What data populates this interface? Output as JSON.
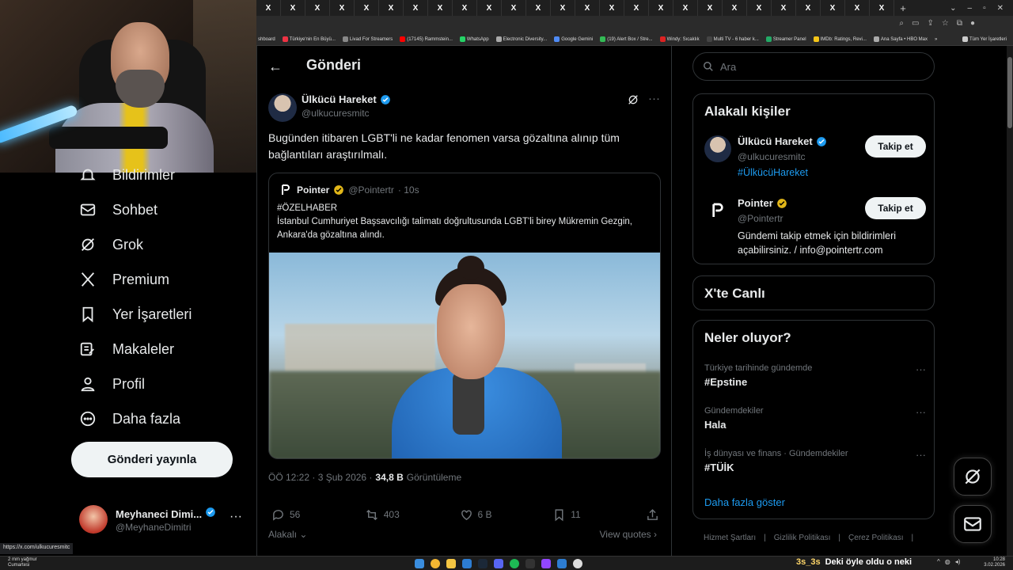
{
  "browser": {
    "tab_count_label": "X",
    "tabs": [
      "X",
      "X",
      "X",
      "X",
      "X",
      "X",
      "X",
      "X",
      "X",
      "X",
      "X",
      "X",
      "X",
      "X",
      "X",
      "X",
      "X",
      "X",
      "X",
      "X",
      "X",
      "X",
      "X",
      "X",
      "X",
      "X",
      "X",
      "X"
    ],
    "new_tab": "+",
    "bookmarks": [
      "shboard",
      "Türkiye'nin En Büyü...",
      "Livad For Streamers",
      "(17145) Rammstein...",
      "WhatsApp",
      "Electronic Diversity...",
      "Google Gemini",
      "(19) Alert Box / Stre...",
      "Windy: Sıcaklık",
      "Multi TV - 6 haber k...",
      "Streamer Panel",
      "IMDb: Ratings, Revi...",
      "Ana Sayfa • HBO Max"
    ],
    "bookmarks_overflow": "»",
    "all_bookmarks": "Tüm Yer İşaretleri",
    "status_url": "https://x.com/ulkucuresmitc"
  },
  "nav": {
    "items": [
      {
        "label": "Bildirimler"
      },
      {
        "label": "Sohbet"
      },
      {
        "label": "Grok"
      },
      {
        "label": "Premium"
      },
      {
        "label": "Yer İşaretleri"
      },
      {
        "label": "Makaleler"
      },
      {
        "label": "Profil"
      },
      {
        "label": "Daha fazla"
      }
    ],
    "post_button": "Gönderi yayınla",
    "account": {
      "name": "Meyhaneci Dimi...",
      "handle": "@MeyhaneDimitri"
    }
  },
  "post": {
    "header": "Gönderi",
    "author": {
      "name": "Ülkücü Hareket",
      "handle": "@ulkucuresmitc"
    },
    "text": "Bugünden itibaren LGBT'li ne kadar fenomen varsa gözaltına alınıp tüm bağlantıları araştırılmalı.",
    "quote": {
      "name": "Pointer",
      "handle": "@Pointertr",
      "time": "· 10s",
      "line1": "#ÖZELHABER",
      "line2": "İstanbul Cumhuriyet Başsavcılığı talimatı doğrultusunda LGBT'li birey Mükremin Gezgin, Ankara'da gözaltına alındı."
    },
    "meta_time": "ÖÖ 12:22 · 3 Şub 2026 ·",
    "views": "34,8 B",
    "views_label": "Görüntüleme",
    "replies": "56",
    "reposts": "403",
    "likes": "6 B",
    "bookmarks": "11",
    "relevance": "Alakalı",
    "view_quotes": "View quotes"
  },
  "right": {
    "search_placeholder": "Ara",
    "related_title": "Alakalı kişiler",
    "people": [
      {
        "name": "Ülkücü Hareket",
        "handle": "@ulkucuresmitc",
        "tag": "#ÜlkücüHareket",
        "follow": "Takip et"
      },
      {
        "name": "Pointer",
        "handle": "@Pointertr",
        "bio": "Gündemi takip etmek için bildirimleri açabilirsiniz. / info@pointertr.com",
        "follow": "Takip et"
      }
    ],
    "live_title": "X'te Canlı",
    "trends_title": "Neler oluyor?",
    "trends": [
      {
        "context": "Türkiye tarihinde gündemde",
        "name": "#Epstine"
      },
      {
        "context": "Gündemdekiler",
        "name": "Hala"
      },
      {
        "context": "İş dünyası ve finans · Gündemdekiler",
        "name": "#TÜİK"
      }
    ],
    "show_more": "Daha fazla göster",
    "footer": [
      "Hizmet Şartları",
      "|",
      "Gizlilik Politikası",
      "|",
      "Çerez Politikası",
      "|"
    ]
  },
  "taskbar": {
    "weather_line1": "2 mm yağmur",
    "weather_line2": "Cumartesi",
    "song_artist": "3s_3s",
    "song_title": "Deki öyle oldu o neki",
    "clock_time": "10:28",
    "clock_date": "3.02.2026"
  },
  "colors": {
    "accent": "#1d9bf0",
    "verified_gold": "#e2b719",
    "border": "#2f3336"
  }
}
